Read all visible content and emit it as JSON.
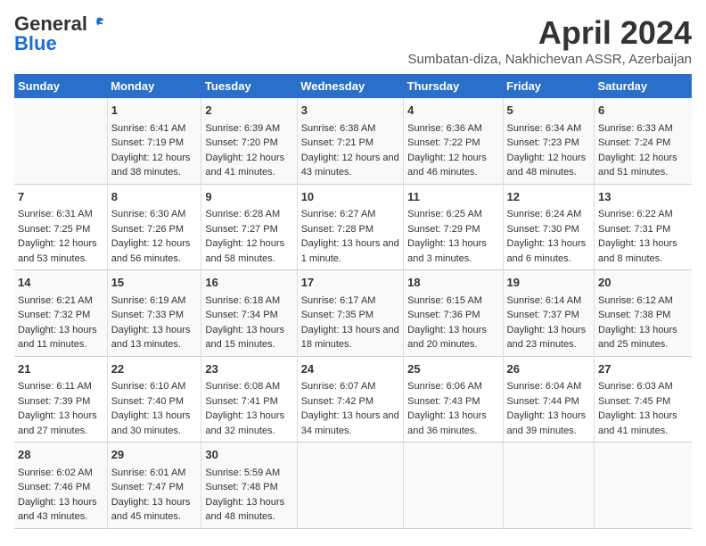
{
  "header": {
    "logo_general": "General",
    "logo_blue": "Blue",
    "month_year": "April 2024",
    "location": "Sumbatan-diza, Nakhichevan ASSR, Azerbaijan"
  },
  "columns": [
    "Sunday",
    "Monday",
    "Tuesday",
    "Wednesday",
    "Thursday",
    "Friday",
    "Saturday"
  ],
  "weeks": [
    [
      {
        "day": "",
        "sunrise": "",
        "sunset": "",
        "daylight": ""
      },
      {
        "day": "1",
        "sunrise": "Sunrise: 6:41 AM",
        "sunset": "Sunset: 7:19 PM",
        "daylight": "Daylight: 12 hours and 38 minutes."
      },
      {
        "day": "2",
        "sunrise": "Sunrise: 6:39 AM",
        "sunset": "Sunset: 7:20 PM",
        "daylight": "Daylight: 12 hours and 41 minutes."
      },
      {
        "day": "3",
        "sunrise": "Sunrise: 6:38 AM",
        "sunset": "Sunset: 7:21 PM",
        "daylight": "Daylight: 12 hours and 43 minutes."
      },
      {
        "day": "4",
        "sunrise": "Sunrise: 6:36 AM",
        "sunset": "Sunset: 7:22 PM",
        "daylight": "Daylight: 12 hours and 46 minutes."
      },
      {
        "day": "5",
        "sunrise": "Sunrise: 6:34 AM",
        "sunset": "Sunset: 7:23 PM",
        "daylight": "Daylight: 12 hours and 48 minutes."
      },
      {
        "day": "6",
        "sunrise": "Sunrise: 6:33 AM",
        "sunset": "Sunset: 7:24 PM",
        "daylight": "Daylight: 12 hours and 51 minutes."
      }
    ],
    [
      {
        "day": "7",
        "sunrise": "Sunrise: 6:31 AM",
        "sunset": "Sunset: 7:25 PM",
        "daylight": "Daylight: 12 hours and 53 minutes."
      },
      {
        "day": "8",
        "sunrise": "Sunrise: 6:30 AM",
        "sunset": "Sunset: 7:26 PM",
        "daylight": "Daylight: 12 hours and 56 minutes."
      },
      {
        "day": "9",
        "sunrise": "Sunrise: 6:28 AM",
        "sunset": "Sunset: 7:27 PM",
        "daylight": "Daylight: 12 hours and 58 minutes."
      },
      {
        "day": "10",
        "sunrise": "Sunrise: 6:27 AM",
        "sunset": "Sunset: 7:28 PM",
        "daylight": "Daylight: 13 hours and 1 minute."
      },
      {
        "day": "11",
        "sunrise": "Sunrise: 6:25 AM",
        "sunset": "Sunset: 7:29 PM",
        "daylight": "Daylight: 13 hours and 3 minutes."
      },
      {
        "day": "12",
        "sunrise": "Sunrise: 6:24 AM",
        "sunset": "Sunset: 7:30 PM",
        "daylight": "Daylight: 13 hours and 6 minutes."
      },
      {
        "day": "13",
        "sunrise": "Sunrise: 6:22 AM",
        "sunset": "Sunset: 7:31 PM",
        "daylight": "Daylight: 13 hours and 8 minutes."
      }
    ],
    [
      {
        "day": "14",
        "sunrise": "Sunrise: 6:21 AM",
        "sunset": "Sunset: 7:32 PM",
        "daylight": "Daylight: 13 hours and 11 minutes."
      },
      {
        "day": "15",
        "sunrise": "Sunrise: 6:19 AM",
        "sunset": "Sunset: 7:33 PM",
        "daylight": "Daylight: 13 hours and 13 minutes."
      },
      {
        "day": "16",
        "sunrise": "Sunrise: 6:18 AM",
        "sunset": "Sunset: 7:34 PM",
        "daylight": "Daylight: 13 hours and 15 minutes."
      },
      {
        "day": "17",
        "sunrise": "Sunrise: 6:17 AM",
        "sunset": "Sunset: 7:35 PM",
        "daylight": "Daylight: 13 hours and 18 minutes."
      },
      {
        "day": "18",
        "sunrise": "Sunrise: 6:15 AM",
        "sunset": "Sunset: 7:36 PM",
        "daylight": "Daylight: 13 hours and 20 minutes."
      },
      {
        "day": "19",
        "sunrise": "Sunrise: 6:14 AM",
        "sunset": "Sunset: 7:37 PM",
        "daylight": "Daylight: 13 hours and 23 minutes."
      },
      {
        "day": "20",
        "sunrise": "Sunrise: 6:12 AM",
        "sunset": "Sunset: 7:38 PM",
        "daylight": "Daylight: 13 hours and 25 minutes."
      }
    ],
    [
      {
        "day": "21",
        "sunrise": "Sunrise: 6:11 AM",
        "sunset": "Sunset: 7:39 PM",
        "daylight": "Daylight: 13 hours and 27 minutes."
      },
      {
        "day": "22",
        "sunrise": "Sunrise: 6:10 AM",
        "sunset": "Sunset: 7:40 PM",
        "daylight": "Daylight: 13 hours and 30 minutes."
      },
      {
        "day": "23",
        "sunrise": "Sunrise: 6:08 AM",
        "sunset": "Sunset: 7:41 PM",
        "daylight": "Daylight: 13 hours and 32 minutes."
      },
      {
        "day": "24",
        "sunrise": "Sunrise: 6:07 AM",
        "sunset": "Sunset: 7:42 PM",
        "daylight": "Daylight: 13 hours and 34 minutes."
      },
      {
        "day": "25",
        "sunrise": "Sunrise: 6:06 AM",
        "sunset": "Sunset: 7:43 PM",
        "daylight": "Daylight: 13 hours and 36 minutes."
      },
      {
        "day": "26",
        "sunrise": "Sunrise: 6:04 AM",
        "sunset": "Sunset: 7:44 PM",
        "daylight": "Daylight: 13 hours and 39 minutes."
      },
      {
        "day": "27",
        "sunrise": "Sunrise: 6:03 AM",
        "sunset": "Sunset: 7:45 PM",
        "daylight": "Daylight: 13 hours and 41 minutes."
      }
    ],
    [
      {
        "day": "28",
        "sunrise": "Sunrise: 6:02 AM",
        "sunset": "Sunset: 7:46 PM",
        "daylight": "Daylight: 13 hours and 43 minutes."
      },
      {
        "day": "29",
        "sunrise": "Sunrise: 6:01 AM",
        "sunset": "Sunset: 7:47 PM",
        "daylight": "Daylight: 13 hours and 45 minutes."
      },
      {
        "day": "30",
        "sunrise": "Sunrise: 5:59 AM",
        "sunset": "Sunset: 7:48 PM",
        "daylight": "Daylight: 13 hours and 48 minutes."
      },
      {
        "day": "",
        "sunrise": "",
        "sunset": "",
        "daylight": ""
      },
      {
        "day": "",
        "sunrise": "",
        "sunset": "",
        "daylight": ""
      },
      {
        "day": "",
        "sunrise": "",
        "sunset": "",
        "daylight": ""
      },
      {
        "day": "",
        "sunrise": "",
        "sunset": "",
        "daylight": ""
      }
    ]
  ]
}
